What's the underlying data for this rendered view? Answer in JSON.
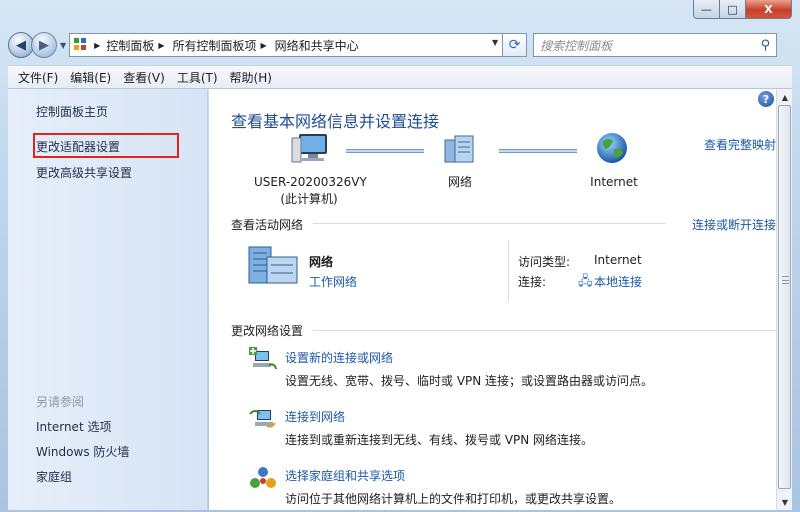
{
  "window_controls": {
    "minimize": "—",
    "maximize": "□",
    "close": "X"
  },
  "address": {
    "back": "◀",
    "forward": "▶",
    "dropdown": "▼",
    "refresh": "⟳",
    "breadcrumbs": [
      {
        "label": "控制面板",
        "arrow": "▶"
      },
      {
        "label": "所有控制面板项",
        "arrow": "▶"
      },
      {
        "label": "网络和共享中心",
        "arrow": ""
      }
    ],
    "search_placeholder": "搜索控制面板",
    "search_icon": "magnifier-icon"
  },
  "menu": [
    "文件(F)",
    "编辑(E)",
    "查看(V)",
    "工具(T)",
    "帮助(H)"
  ],
  "sidebar": {
    "home": "控制面板主页",
    "adapter": "更改适配器设置",
    "advanced": "更改高级共享设置",
    "see_also": "另请参阅",
    "links": [
      "Internet 选项",
      "Windows 防火墙",
      "家庭组"
    ]
  },
  "content": {
    "help_icon": "?",
    "title": "查看基本网络信息并设置连接",
    "full_map": "查看完整映射",
    "map": {
      "computer_name": "USER-20200326VY",
      "computer_sub": "(此计算机)",
      "network": "网络",
      "internet": "Internet"
    },
    "active_header": "查看活动网络",
    "connect_disconnect": "连接或断开连接",
    "active": {
      "name": "网络",
      "type": "工作网络",
      "access_label": "访问类型:",
      "access_value": "Internet",
      "conn_label": "连接:",
      "conn_value": "本地连接"
    },
    "change_header": "更改网络设置",
    "tasks": [
      {
        "title": "设置新的连接或网络",
        "desc": "设置无线、宽带、拨号、临时或 VPN 连接；或设置路由器或访问点。"
      },
      {
        "title": "连接到网络",
        "desc": "连接到或重新连接到无线、有线、拨号或 VPN 网络连接。"
      },
      {
        "title": "选择家庭组和共享选项",
        "desc": "访问位于其他网络计算机上的文件和打印机，或更改共享设置。"
      }
    ]
  },
  "scrollbar": {
    "up": "▲",
    "down": "▼"
  },
  "colors": {
    "link": "#1c57aa",
    "title": "#1f4c93",
    "highlight_box": "#e0251b"
  }
}
